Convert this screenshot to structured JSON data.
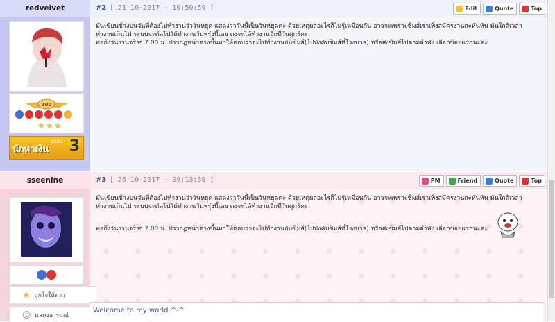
{
  "posts": [
    {
      "username": "redvelvet",
      "number": "#2",
      "date": "[ 21-10-2017 - 10:50:59 ]",
      "buttons": [
        "Edit",
        "Quote",
        "Top"
      ],
      "body": [
        "มันเขียนข้างบนวันที่ต้องไปทำงานว่าวันหยุด แสดงว่าวันนี้เป็นวันหยุดคะ ด้วยเหตุผลอะไรก็ไม่รู้เหมือนกัน อาจจะเพราะซิมส์เราเพิ่งสมัครงานกะทันหัน มันใกล้เวลา",
        "ทำงานเกินไป ระบบจะตัดไปให้ทำงานวันพรุ่งนี้เลย ดงจะได้ทำงานอีกทีวันศุกร์คะ",
        "พอถึงวันงานจริงๆ 7.00 น. ปรากฏหน้าต่างขึ้นมาให้ตอบว่าจะไปทำงานกับซิมส์(ไปบังคับซิมส์ที่โรงบาล) หรือส่งซิมส์ไปตามลำพัง เลือกข้อยแรกนะคะ"
      ],
      "rank_level": "100",
      "banner_text": "นักหาเงิน",
      "banner_small": "อันดับ",
      "banner_num": "3"
    },
    {
      "username": "sseenine",
      "number": "#3",
      "date": "[ 26-10-2017 - 09:13:39 ]",
      "buttons": [
        "PM",
        "Friend",
        "Quote",
        "Top"
      ],
      "body": [
        "มันเขียนข้างบนวันที่ต้องไปทำงานว่าวันหยุด แสดงว่าวันนี้เป็นวันหยุดคะ ด้วยเหตุผลอะไรก็ไม่รู้เหมือนกัน อาจจะเพราะซิมส์เราเพิ่งสมัครงานกะทันหัน มันใกล้เวลา",
        "ทำงานเกินไป ระบบจะตัดไปให้ทำงานวันพรุ่งนี้เลย ดงจะได้ทำงานอีกทีวันศุกร์คะ",
        "พอถึงวันงานจริงๆ 7.00 น. ปรากฏหน้าต่างขึ้นมาให้ตอบว่าจะไปทำงานกับซิมส์(ไปบังคับซิมส์ที่โรงบาล) หรือส่งซิมส์ไปตามลำพัง เลือกข้อยแรกนะคะ"
      ],
      "like_label": "ถูกใจให้ดาว",
      "mood_label": "แสดงอารมณ์",
      "signature": "Welcome to my world.^-^"
    }
  ],
  "colors": {
    "accent": "#2b49a8",
    "post1_side": "#c6c6f3",
    "post2_side": "#f6d4dc"
  }
}
